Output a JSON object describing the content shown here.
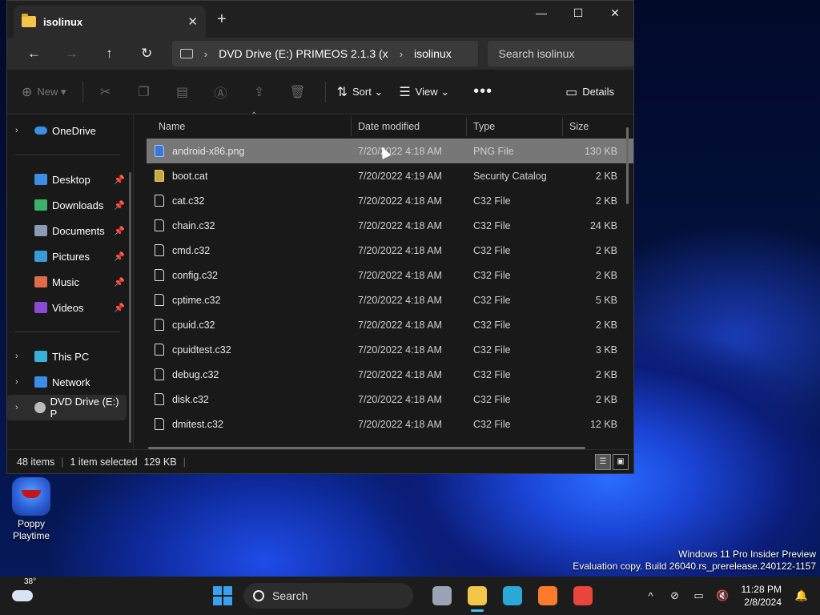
{
  "desktop": {
    "icons": [
      {
        "label": "Poppy Playtime"
      }
    ],
    "watermark": {
      "line1": "Windows 11 Pro Insider Preview",
      "line2": "Evaluation copy. Build 26040.rs_prerelease.240122-1157"
    }
  },
  "window": {
    "tab_title": "isolinux",
    "address": {
      "drive": "DVD Drive (E:) PRIMEOS 2.1.3 (x",
      "folder": "isolinux"
    },
    "search_placeholder": "Search isolinux",
    "toolbar": {
      "new_label": "New",
      "sort_label": "Sort",
      "view_label": "View",
      "details_label": "Details"
    },
    "nav": {
      "onedrive": "OneDrive",
      "quick": [
        {
          "label": "Desktop",
          "color": "#3a8ee6"
        },
        {
          "label": "Downloads",
          "color": "#3ab06a"
        },
        {
          "label": "Documents",
          "color": "#8a9bb8"
        },
        {
          "label": "Pictures",
          "color": "#3a9ad6"
        },
        {
          "label": "Music",
          "color": "#e06a4a"
        },
        {
          "label": "Videos",
          "color": "#8a4ad6"
        }
      ],
      "this_pc": "This PC",
      "network": "Network",
      "dvd": "DVD Drive (E:) P"
    },
    "columns": {
      "name": "Name",
      "date": "Date modified",
      "type": "Type",
      "size": "Size"
    },
    "files": [
      {
        "name": "android-x86.png",
        "date": "7/20/2022 4:18 AM",
        "type": "PNG File",
        "size": "130 KB",
        "icon": "png",
        "selected": true
      },
      {
        "name": "boot.cat",
        "date": "7/20/2022 4:19 AM",
        "type": "Security Catalog",
        "size": "2 KB",
        "icon": "cat"
      },
      {
        "name": "cat.c32",
        "date": "7/20/2022 4:18 AM",
        "type": "C32 File",
        "size": "2 KB",
        "icon": "file"
      },
      {
        "name": "chain.c32",
        "date": "7/20/2022 4:18 AM",
        "type": "C32 File",
        "size": "24 KB",
        "icon": "file"
      },
      {
        "name": "cmd.c32",
        "date": "7/20/2022 4:18 AM",
        "type": "C32 File",
        "size": "2 KB",
        "icon": "file"
      },
      {
        "name": "config.c32",
        "date": "7/20/2022 4:18 AM",
        "type": "C32 File",
        "size": "2 KB",
        "icon": "file"
      },
      {
        "name": "cptime.c32",
        "date": "7/20/2022 4:18 AM",
        "type": "C32 File",
        "size": "5 KB",
        "icon": "file"
      },
      {
        "name": "cpuid.c32",
        "date": "7/20/2022 4:18 AM",
        "type": "C32 File",
        "size": "2 KB",
        "icon": "file"
      },
      {
        "name": "cpuidtest.c32",
        "date": "7/20/2022 4:18 AM",
        "type": "C32 File",
        "size": "3 KB",
        "icon": "file"
      },
      {
        "name": "debug.c32",
        "date": "7/20/2022 4:18 AM",
        "type": "C32 File",
        "size": "2 KB",
        "icon": "file"
      },
      {
        "name": "disk.c32",
        "date": "7/20/2022 4:18 AM",
        "type": "C32 File",
        "size": "2 KB",
        "icon": "file"
      },
      {
        "name": "dmitest.c32",
        "date": "7/20/2022 4:18 AM",
        "type": "C32 File",
        "size": "12 KB",
        "icon": "file"
      }
    ],
    "status": {
      "items": "48 items",
      "selected": "1 item selected",
      "size": "129 KB"
    }
  },
  "taskbar": {
    "weather_temp": "38°",
    "search_label": "Search",
    "apps": [
      {
        "name": "task-view-icon",
        "color": "#9aa4b4"
      },
      {
        "name": "file-explorer-icon",
        "color": "#f3c64a",
        "active": true
      },
      {
        "name": "edge-icon",
        "color": "#2aa8d8"
      },
      {
        "name": "firefox-icon",
        "color": "#ff7a2a"
      },
      {
        "name": "chrome-icon",
        "color": "#e8453c"
      }
    ],
    "time": "11:28 PM",
    "date": "2/8/2024"
  }
}
